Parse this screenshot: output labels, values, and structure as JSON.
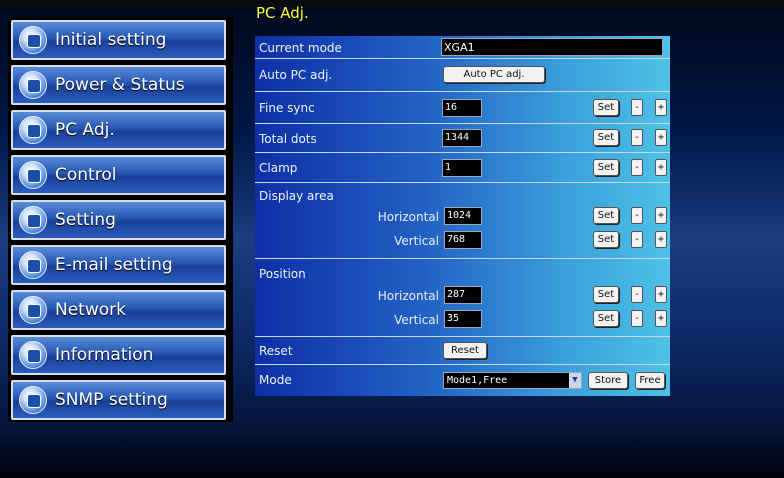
{
  "sidebar": {
    "items": [
      {
        "label": "Initial setting",
        "icon": "initial-setting-icon"
      },
      {
        "label": "Power & Status",
        "icon": "power-status-icon"
      },
      {
        "label": "PC Adj.",
        "icon": "pc-adj-icon"
      },
      {
        "label": "Control",
        "icon": "control-icon"
      },
      {
        "label": "Setting",
        "icon": "setting-icon"
      },
      {
        "label": "E-mail setting",
        "icon": "email-icon"
      },
      {
        "label": "Network",
        "icon": "network-icon"
      },
      {
        "label": "Information",
        "icon": "information-icon"
      },
      {
        "label": "SNMP setting",
        "icon": "snmp-icon"
      }
    ]
  },
  "page": {
    "title": "PC Adj."
  },
  "rows": {
    "current_mode": {
      "label": "Current mode",
      "value": "XGA1"
    },
    "auto_pc_adj": {
      "label": "Auto PC adj.",
      "button": "Auto PC adj."
    },
    "fine_sync": {
      "label": "Fine sync",
      "value": "16"
    },
    "total_dots": {
      "label": "Total dots",
      "value": "1344"
    },
    "clamp": {
      "label": "Clamp",
      "value": "1"
    },
    "display_area": {
      "label": "Display area",
      "horizontal_label": "Horizontal",
      "horizontal_value": "1024",
      "vertical_label": "Vertical",
      "vertical_value": "768"
    },
    "position": {
      "label": "Position",
      "horizontal_label": "Horizontal",
      "horizontal_value": "287",
      "vertical_label": "Vertical",
      "vertical_value": "35"
    },
    "reset": {
      "label": "Reset",
      "button": "Reset"
    },
    "mode": {
      "label": "Mode",
      "selected": "Mode1,Free",
      "store": "Store",
      "free": "Free"
    }
  },
  "buttons": {
    "set": "Set",
    "minus": "-",
    "plus": "+"
  },
  "colors": {
    "title": "#ffff33",
    "nav_blue": "#2456b4"
  }
}
